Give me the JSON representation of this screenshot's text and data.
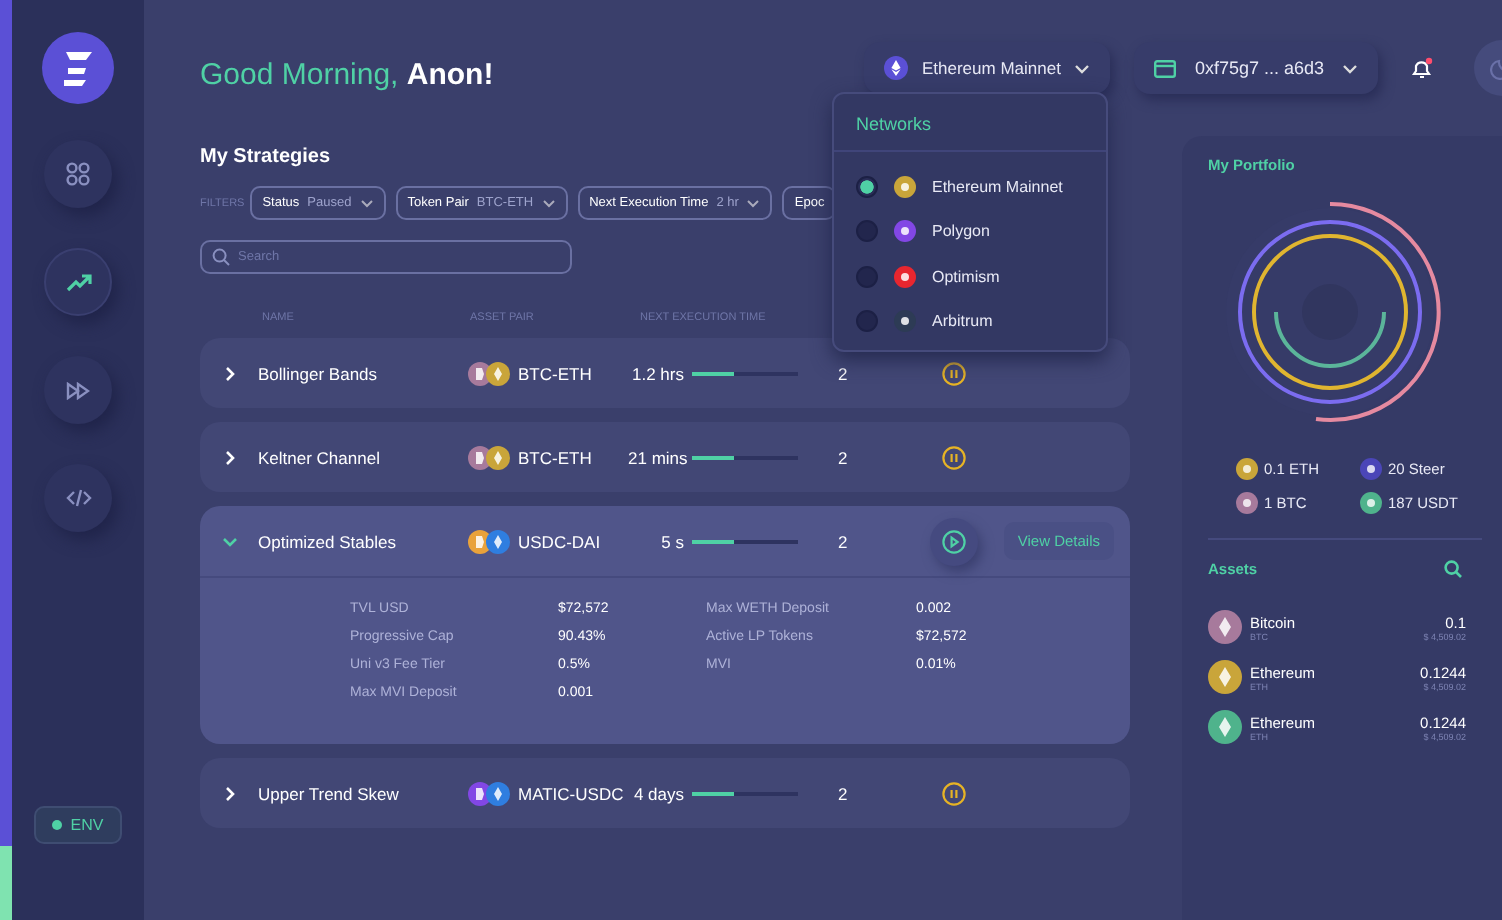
{
  "sidebar": {
    "nav": [
      {
        "kind": "grid",
        "selected": false
      },
      {
        "kind": "trend",
        "selected": true
      },
      {
        "kind": "forward",
        "selected": false
      },
      {
        "kind": "code",
        "selected": false
      }
    ],
    "env": {
      "label": "ENV",
      "on": true
    }
  },
  "header": {
    "greeting": "Good Morning,",
    "name": "Anon!",
    "network": "Ethereum Mainnet",
    "wallet": "0xf75g7 ... a6d3",
    "unread_notifications": true
  },
  "networks_menu": {
    "title": "Networks",
    "items": [
      {
        "label": "Ethereum Mainnet",
        "kind": "eth",
        "selected": true
      },
      {
        "label": "Polygon",
        "kind": "matic",
        "selected": false
      },
      {
        "label": "Optimism",
        "kind": "op",
        "selected": false
      },
      {
        "label": "Arbitrum",
        "kind": "arb",
        "selected": false
      }
    ]
  },
  "strategies": {
    "title": "My Strategies",
    "filters_label": "FILTERS",
    "filters": [
      {
        "label": "Status",
        "value": "Paused"
      },
      {
        "label": "Token Pair",
        "value": "BTC-ETH"
      },
      {
        "label": "Next Execution Time",
        "value": "2 hr"
      },
      {
        "label": "Epoc"
      }
    ],
    "search": {
      "placeholder": "Search"
    },
    "columns": [
      "NAME",
      "ASSET PAIR",
      "NEXT EXECUTION TIME"
    ],
    "rows": [
      {
        "name": "Bollinger Bands",
        "expanded": false,
        "coins": [
          {
            "kind": "btc"
          },
          {
            "kind": "eth"
          }
        ],
        "pair": "BTC-ETH",
        "time": "1.2 hrs",
        "level": 0.4,
        "count": "2",
        "paused": true
      },
      {
        "name": "Keltner Channel",
        "expanded": false,
        "coins": [
          {
            "kind": "btc"
          },
          {
            "kind": "eth"
          }
        ],
        "pair": "BTC-ETH",
        "time": "21 mins",
        "level": 0.4,
        "count": "2",
        "paused": true
      },
      {
        "name": "Optimized Stables",
        "expanded": true,
        "coins": [
          {
            "kind": "dai"
          },
          {
            "kind": "usdc"
          }
        ],
        "pair": "USDC-DAI",
        "time": "5 s",
        "level": 0.4,
        "count": "2",
        "paused": false,
        "action": "View Details",
        "details": [
          {
            "label": "TVL USD",
            "value": "$72,572"
          },
          {
            "label": "Max WETH Deposit",
            "value": "0.002"
          },
          {
            "label": "Progressive Cap",
            "value": "90.43%"
          },
          {
            "label": "Active LP Tokens",
            "value": "$72,572"
          },
          {
            "label": "Uni v3 Fee Tier",
            "value": "0.5%"
          },
          {
            "label": "MVI",
            "value": "0.01%"
          },
          {
            "label": "Max MVI Deposit",
            "value": "0.001"
          }
        ]
      },
      {
        "name": "Upper Trend Skew",
        "expanded": false,
        "coins": [
          {
            "kind": "matic"
          },
          {
            "kind": "usdc"
          }
        ],
        "pair": "MATIC-USDC",
        "time": "4 days",
        "level": 0.4,
        "count": "2",
        "paused": true
      }
    ]
  },
  "portfolio": {
    "title": "My Portfolio",
    "holdings": [
      {
        "label": "0.1 ETH",
        "kind": "eth"
      },
      {
        "label": "20 Steer",
        "kind": "steer"
      },
      {
        "label": "1 BTC",
        "kind": "btc"
      },
      {
        "label": "187 USDT",
        "kind": "usdt"
      }
    ],
    "assets_title": "Assets",
    "assets": [
      {
        "name": "Bitcoin",
        "symbol": "BTC",
        "amount": "0.1",
        "value": "$ 4,509.02",
        "kind": "btc"
      },
      {
        "name": "Ethereum",
        "symbol": "ETH",
        "amount": "0.1244",
        "value": "$ 4,509.02",
        "kind": "eth"
      },
      {
        "name": "Ethereum",
        "symbol": "ETH",
        "amount": "0.1244",
        "value": "$ 4,509.02",
        "kind": "usdt"
      }
    ]
  }
}
